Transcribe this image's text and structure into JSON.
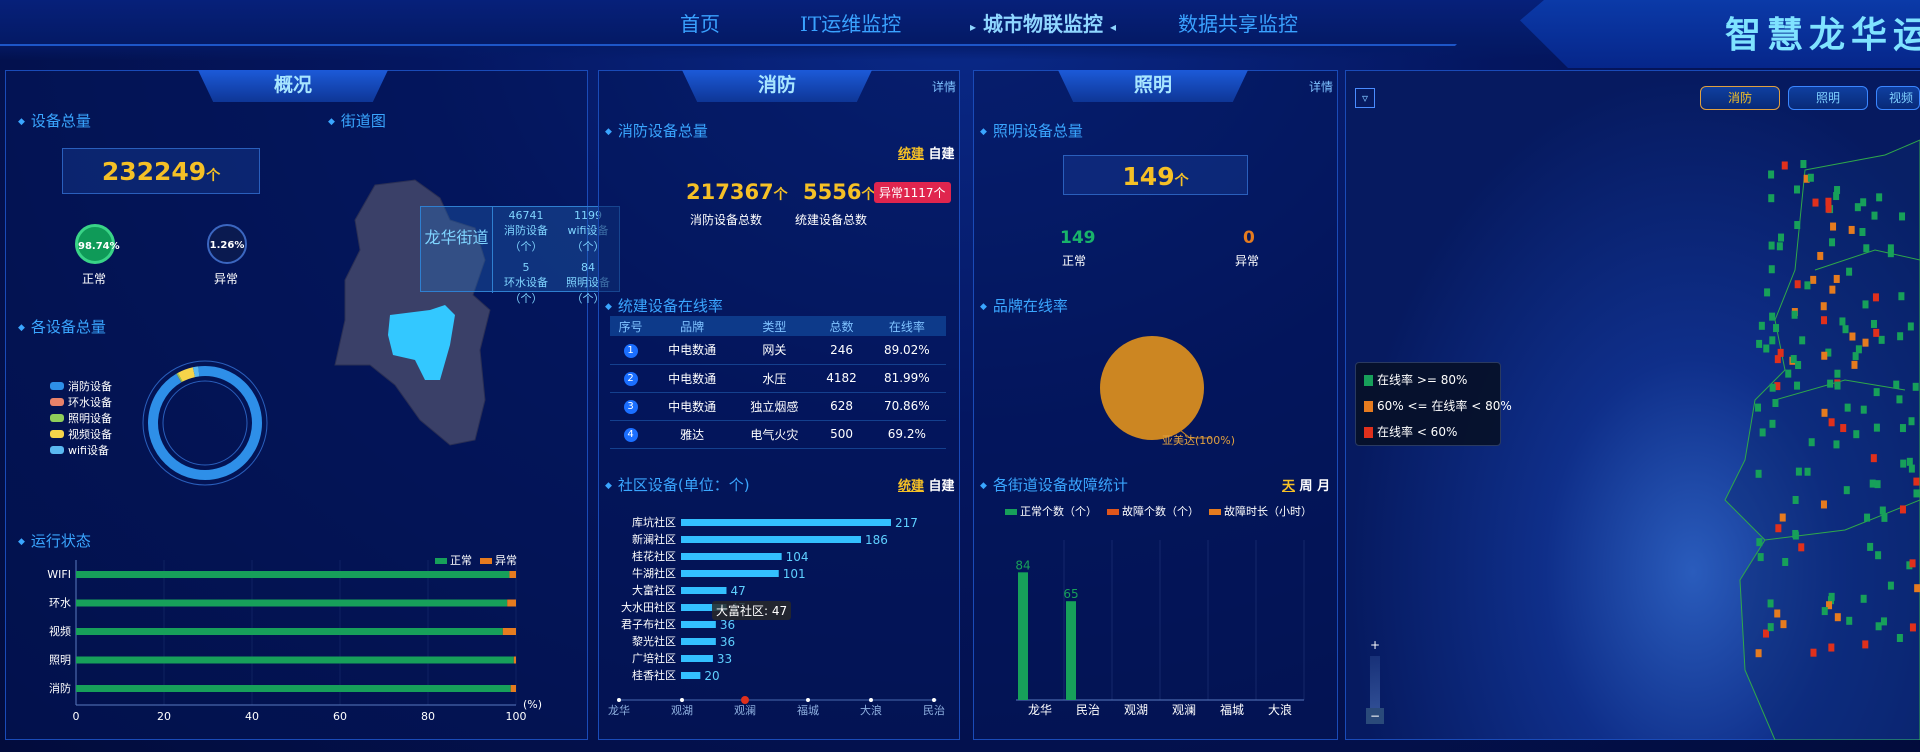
{
  "nav": {
    "items": [
      "首页",
      "IT运维监控",
      "城市物联监控",
      "数据共享监控"
    ],
    "active": "城市物联监控",
    "brand": "智慧龙华运"
  },
  "overview": {
    "title": "概况",
    "device_total_label": "设备总量",
    "street_map_label": "街道图",
    "total": "232249",
    "unit": "个",
    "normal_pct": "98.74%",
    "normal_label": "正常",
    "abnormal_pct": "1.26%",
    "abnormal_label": "异常",
    "street_popup": {
      "name": "龙华街道",
      "items": [
        {
          "value": "46741",
          "label": "消防设备（个）"
        },
        {
          "value": "1199",
          "label": "wifi设备（个）"
        },
        {
          "value": "5",
          "label": "环水设备（个）"
        },
        {
          "value": "84",
          "label": "照明设备（个）"
        }
      ]
    },
    "each_total_label": "各设备总量",
    "donut_legend": [
      {
        "name": "消防设备",
        "color": "#2e8fe8"
      },
      {
        "name": "环水设备",
        "color": "#e8826a"
      },
      {
        "name": "照明设备",
        "color": "#8fce5a"
      },
      {
        "name": "视频设备",
        "color": "#f5d44a"
      },
      {
        "name": "wifi设备",
        "color": "#5ab8f0"
      }
    ],
    "run_status_label": "运行状态",
    "run_legend": [
      {
        "name": "正常",
        "color": "#17a05a"
      },
      {
        "name": "异常",
        "color": "#e57b1f"
      }
    ],
    "run_unit": "(%)"
  },
  "fire": {
    "title": "消防",
    "detail": "详情",
    "total_label": "消防设备总量",
    "toggle": [
      "统建",
      "自建"
    ],
    "fire_total": "217367",
    "fire_total_unit": "个",
    "fire_total_label": "消防设备总数",
    "unified_total": "5556",
    "unified_total_unit": "个",
    "unified_total_label": "统建设备总数",
    "alert": "异常1117个",
    "online_label": "统建设备在线率",
    "table_headers": [
      "序号",
      "品牌",
      "类型",
      "总数",
      "在线率"
    ],
    "table_rows": [
      {
        "no": "1",
        "brand": "中电数通",
        "type": "网关",
        "total": "246",
        "rate": "89.02%"
      },
      {
        "no": "2",
        "brand": "中电数通",
        "type": "水压",
        "total": "4182",
        "rate": "81.99%"
      },
      {
        "no": "3",
        "brand": "中电数通",
        "type": "独立烟感",
        "total": "628",
        "rate": "70.86%"
      },
      {
        "no": "4",
        "brand": "雅达",
        "type": "电气火灾",
        "total": "500",
        "rate": "69.2%"
      }
    ],
    "community_label": "社区设备(单位：个)",
    "community_toggle": [
      "统建",
      "自建"
    ],
    "tooltip": "大富社区: 47",
    "timeline": [
      "龙华",
      "观湖",
      "观澜",
      "福城",
      "大浪",
      "民治"
    ],
    "timeline_active": 2
  },
  "light": {
    "title": "照明",
    "detail": "详情",
    "total_label": "照明设备总量",
    "total": "149",
    "unit": "个",
    "normal": "149",
    "normal_label": "正常",
    "abnormal": "0",
    "abnormal_label": "异常",
    "brand_online_label": "品牌在线率",
    "pie_label": "亚美达(100%)",
    "fault_label": "各街道设备故障统计",
    "fault_toggle": [
      "天",
      "周",
      "月"
    ],
    "fault_legend": [
      {
        "name": "正常个数（个）",
        "color": "#17a05a"
      },
      {
        "name": "故障个数（个）",
        "color": "#e0561c"
      },
      {
        "name": "故障时长（小时）",
        "color": "#e57b1f"
      }
    ]
  },
  "map": {
    "tabs": [
      "消防",
      "照明",
      "视频"
    ],
    "legend": [
      {
        "name": "在线率 >= 80%",
        "color": "#17a05a"
      },
      {
        "name": "60% <= 在线率 < 80%",
        "color": "#e57b1f"
      },
      {
        "name": "在线率 < 60%",
        "color": "#e0301c"
      }
    ],
    "zoom_in": "+",
    "zoom_out": "−"
  },
  "chart_data": [
    {
      "type": "bar",
      "title": "运行状态",
      "categories": [
        "WIFI",
        "环水",
        "视频",
        "照明",
        "消防"
      ],
      "series": [
        {
          "name": "正常",
          "values": [
            98.5,
            98,
            97,
            99.5,
            98.8
          ]
        },
        {
          "name": "异常",
          "values": [
            1.5,
            2,
            3,
            0.5,
            1.2
          ]
        }
      ],
      "xlim": [
        0,
        100
      ],
      "xticks": [
        0,
        20,
        40,
        60,
        80,
        100
      ]
    },
    {
      "type": "bar",
      "title": "社区设备(单位：个)",
      "categories": [
        "库坑社区",
        "新澜社区",
        "桂花社区",
        "牛湖社区",
        "大富社区",
        "大水田社区",
        "君子布社区",
        "黎光社区",
        "广培社区",
        "桂香社区"
      ],
      "values": [
        217,
        186,
        104,
        101,
        47,
        47,
        36,
        36,
        33,
        20
      ]
    },
    {
      "type": "bar",
      "title": "各街道设备故障统计",
      "categories": [
        "龙华",
        "民治",
        "观湖",
        "观澜",
        "福城",
        "大浪"
      ],
      "series": [
        {
          "name": "正常个数（个）",
          "values": [
            84,
            65,
            0,
            0,
            0,
            0
          ]
        },
        {
          "name": "故障个数（个）",
          "values": [
            0,
            0,
            0,
            0,
            0,
            0
          ]
        },
        {
          "name": "故障时长（小时）",
          "values": [
            0,
            0,
            0,
            0,
            0,
            0
          ]
        }
      ]
    },
    {
      "type": "pie",
      "title": "品牌在线率",
      "categories": [
        "亚美达"
      ],
      "values": [
        100
      ]
    },
    {
      "type": "pie",
      "title": "各设备总量",
      "categories": [
        "消防设备",
        "环水设备",
        "照明设备",
        "视频设备",
        "wifi设备"
      ],
      "values": [
        93.5,
        0.1,
        0.4,
        4.5,
        1.5
      ]
    }
  ]
}
